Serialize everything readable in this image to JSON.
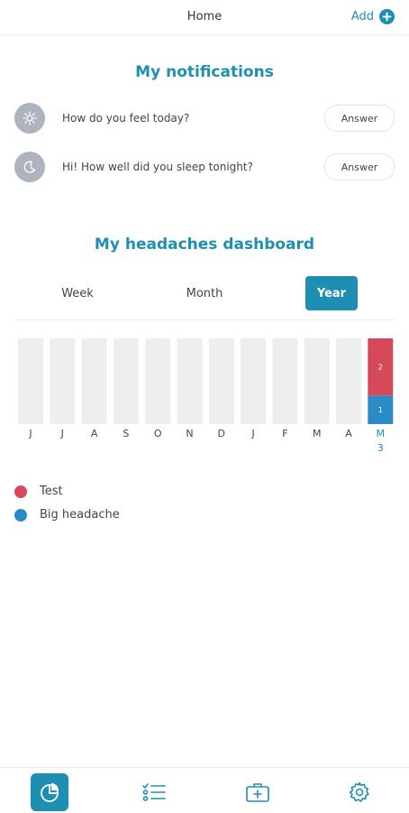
{
  "header": {
    "title": "Home",
    "add_label": "Add"
  },
  "notifications": {
    "title": "My notifications",
    "items": [
      {
        "text": "How do you feel today?",
        "icon": "sun-icon",
        "button_label": "Answer"
      },
      {
        "text": "Hi! How well did you sleep tonight?",
        "icon": "moon-icon",
        "button_label": "Answer"
      }
    ]
  },
  "dashboard": {
    "title": "My headaches dashboard",
    "tabs": [
      {
        "label": "Week",
        "active": false
      },
      {
        "label": "Month",
        "active": false
      },
      {
        "label": "Year",
        "active": true
      }
    ]
  },
  "chart_data": {
    "type": "bar",
    "categories": [
      "J",
      "J",
      "A",
      "S",
      "O",
      "N",
      "D",
      "J",
      "F",
      "M",
      "A",
      "M"
    ],
    "totals_label": [
      "",
      "",
      "",
      "",
      "",
      "",
      "",
      "",
      "",
      "",
      "",
      "3"
    ],
    "highlight_index": 11,
    "series": [
      {
        "name": "Big headache",
        "color": "#2b8bc6",
        "values": [
          0,
          0,
          0,
          0,
          0,
          0,
          0,
          0,
          0,
          0,
          0,
          1
        ]
      },
      {
        "name": "Test",
        "color": "#d5495a",
        "values": [
          0,
          0,
          0,
          0,
          0,
          0,
          0,
          0,
          0,
          0,
          0,
          2
        ]
      }
    ]
  },
  "legend": [
    {
      "label": "Test",
      "color": "#d5495a"
    },
    {
      "label": "Big headache",
      "color": "#2b8bc6"
    }
  ],
  "bottom_nav": [
    {
      "icon": "dashboard-icon",
      "active": true
    },
    {
      "icon": "checklist-icon",
      "active": false
    },
    {
      "icon": "medical-kit-icon",
      "active": false
    },
    {
      "icon": "gear-icon",
      "active": false
    }
  ]
}
